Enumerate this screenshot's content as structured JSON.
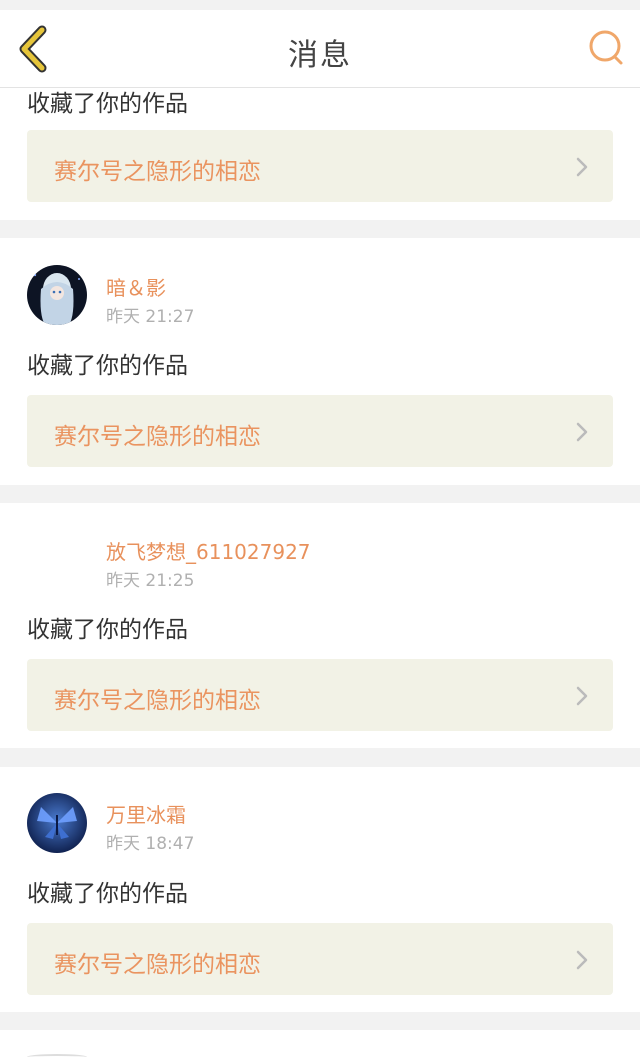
{
  "header": {
    "title": "消息",
    "back_icon": "chevron-left-icon",
    "search_icon": "search-icon"
  },
  "colors": {
    "accent": "#e8915c",
    "back": "#e6c53a",
    "link_bg": "#f2f2e6"
  },
  "notifications": [
    {
      "action": "收藏了你的作品",
      "work": "赛尔号之隐形的相恋"
    },
    {
      "user": "暗＆影",
      "time": "昨天 21:27",
      "action": "收藏了你的作品",
      "work": "赛尔号之隐形的相恋"
    },
    {
      "user": "放飞梦想_611027927",
      "time": "昨天 21:25",
      "action": "收藏了你的作品",
      "work": "赛尔号之隐形的相恋"
    },
    {
      "user": "万里冰霜",
      "time": "昨天 18:47",
      "action": "收藏了你的作品",
      "work": "赛尔号之隐形的相恋"
    }
  ]
}
